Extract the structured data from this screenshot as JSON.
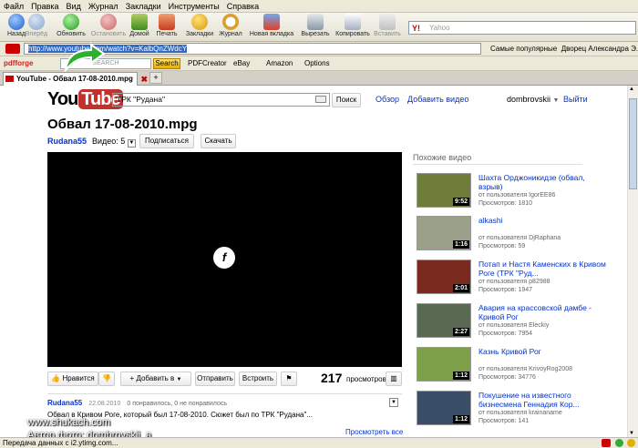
{
  "menu": [
    "Файл",
    "Правка",
    "Вид",
    "Журнал",
    "Закладки",
    "Инструменты",
    "Справка"
  ],
  "nav": {
    "back": "Назад",
    "forward": "Вперёд",
    "refresh": "Обновить",
    "stop": "Остановить",
    "home": "Домой",
    "print": "Печать",
    "bookmarks": "Закладки",
    "history": "Журнал",
    "newtab": "Новая вкладка",
    "cut": "Вырезать",
    "copy": "Копировать",
    "paste": "Вставить"
  },
  "yahoo_placeholder": "Yahoo",
  "url": "http://www.youtube.com/watch?v=KalbQnZWdcY",
  "bookmarks": [
    "Самые популярные",
    "Дворец Александра Э..."
  ],
  "pdfbar": {
    "brand": "pdfforge",
    "search_placeholder": "SEARCH",
    "search": "Search",
    "pdfcreator": "PDFCreator",
    "ebay": "eBay",
    "amazon": "Amazon",
    "options": "Options"
  },
  "tab": {
    "title": "YouTube - Обвал 17-08-2010.mpg"
  },
  "yt": {
    "logo_you": "You",
    "logo_tube": "Tube",
    "search_value": "ТРК \"Рудана\"",
    "search_button": "Поиск",
    "browse": "Обзор",
    "upload": "Добавить видео",
    "user": "dombrovskii",
    "logout": "Выйти",
    "title": "Обвал 17-08-2010.mpg",
    "channel": "Rudana55",
    "videos_label": "Видео: 5",
    "subscribe": "Подписаться",
    "download": "Скачать",
    "like": "Нравится",
    "add_to": "Добавить в",
    "share": "Отправить",
    "embed": "Встроить",
    "views": "217",
    "views_label": "просмотров",
    "desc_user": "Rudana55",
    "desc_date": "22.08.2010",
    "desc_likes": "0 понравилось, 0 не понравилось",
    "desc_text": "Обвал в Кривом Роге, который был 17-08-2010. Сюжет был по ТРК \"Рудана\"...",
    "see_all": "Просмотреть все",
    "related_heading": "Похожие видео",
    "related": [
      {
        "title": "Шахта Орджоникидзе (обвал, взрыв)",
        "user": "от пользователя IgorEE86",
        "views": "Просмотров: 1810",
        "dur": "9:52",
        "color": "#6e7e3a"
      },
      {
        "title": "alkashi",
        "user": "от пользователя DjRaphana",
        "views": "Просмотров: 59",
        "dur": "1:16",
        "color": "#9aa08a"
      },
      {
        "title": "Потап и Настя Каменских в Кривом Роге (ТРК \"Руд...",
        "user": "от пользователя p82988",
        "views": "Просмотров: 1947",
        "dur": "2:01",
        "color": "#7a2a1e"
      },
      {
        "title": "Авария на крассовской дамбе - Кривой Рог",
        "user": "от пользователя Eleckiy",
        "views": "Просмотров: 7954",
        "dur": "2:27",
        "color": "#5a6a52"
      },
      {
        "title": "Казнь Кривой Рог",
        "user": "от пользователя KrivoyRog2008",
        "views": "Просмотров: 34776",
        "dur": "1:12",
        "color": "#7ea04a"
      },
      {
        "title": "Покушение на известного бизнесмена Геннадия Кор...",
        "user": "от пользователя krainaname",
        "views": "Просмотров: 141",
        "dur": "1:12",
        "color": "#3a4e6a"
      }
    ]
  },
  "watermark": {
    "site": "www.shukach.com",
    "author": "Автор фото: dombrovskii_a"
  },
  "status": "Передача данных с i2.ytimg.com..."
}
